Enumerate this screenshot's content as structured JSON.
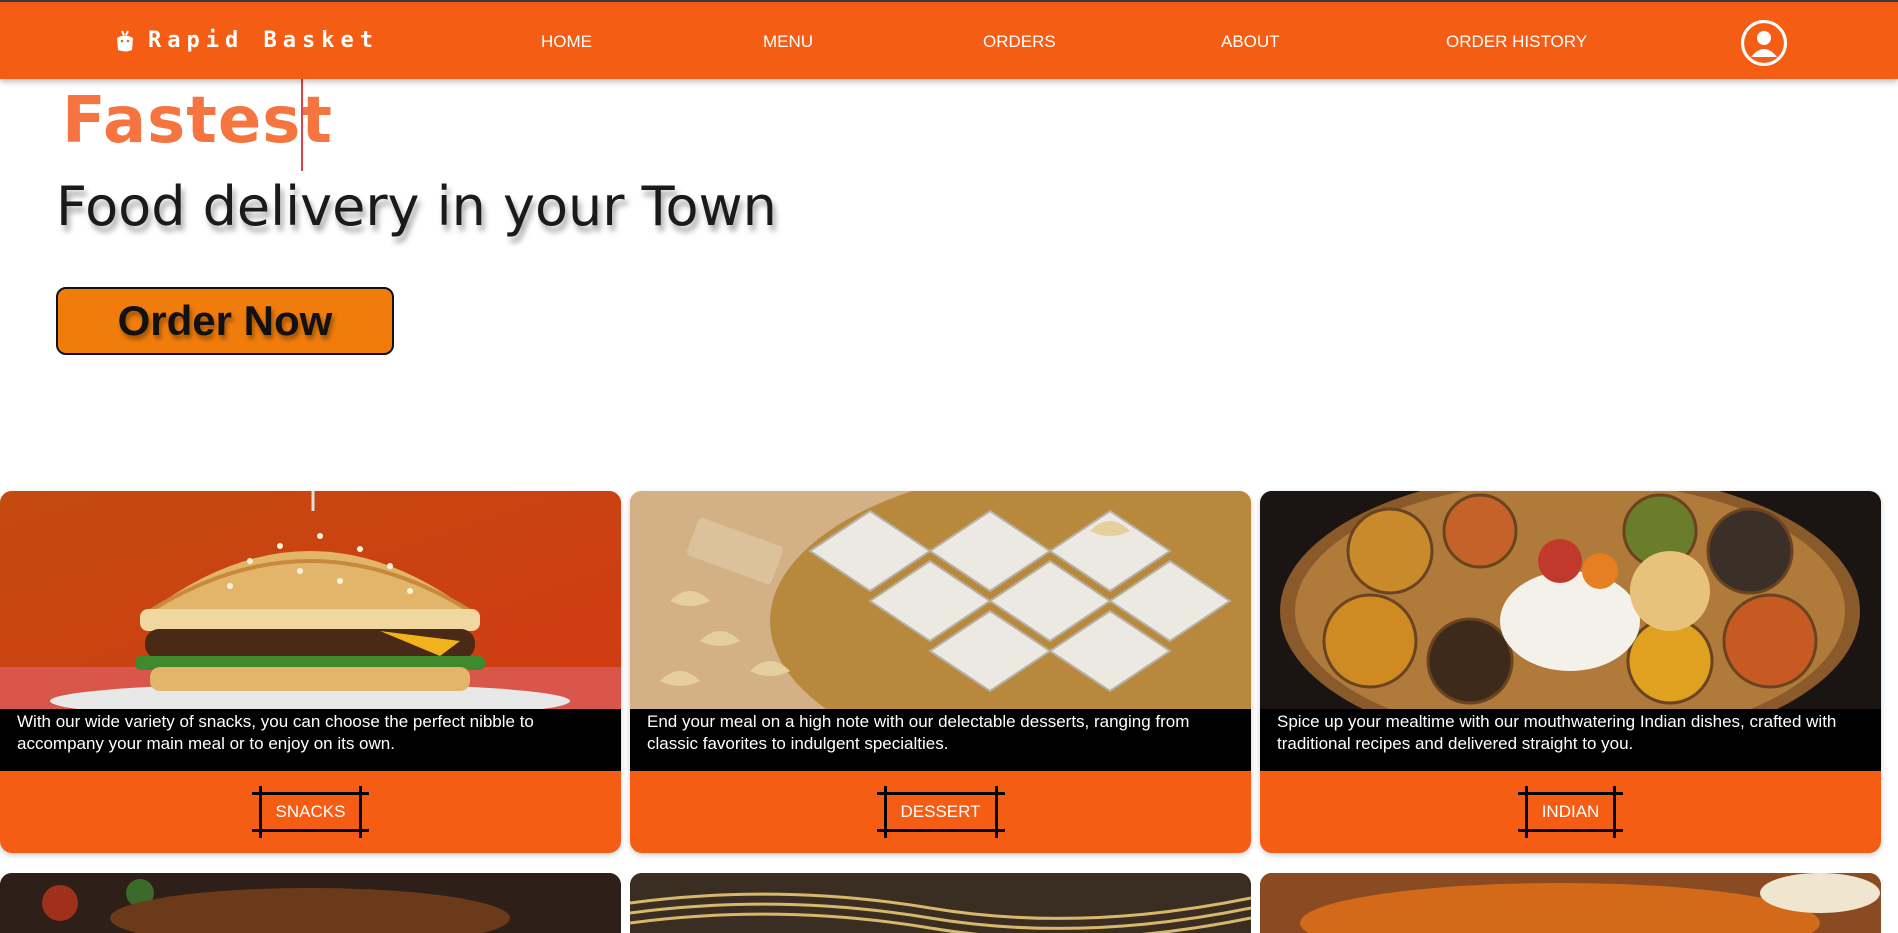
{
  "brand": {
    "name": "Rapid Basket",
    "icon": "basket-icon"
  },
  "nav": {
    "items": [
      {
        "label": "HOME"
      },
      {
        "label": "MENU"
      },
      {
        "label": "ORDERS"
      },
      {
        "label": "ABOUT"
      },
      {
        "label": "ORDER HISTORY"
      }
    ],
    "profile_icon": "user-avatar-icon"
  },
  "hero": {
    "headline": "Fastest",
    "tagline": "Food delivery in your Town",
    "cta_label": "Order Now"
  },
  "categories": [
    {
      "label": "SNACKS",
      "description": "With our wide variety of snacks, you can choose the perfect nibble to accompany your main meal or to enjoy on its own.",
      "image": "burger"
    },
    {
      "label": "DESSERT",
      "description": "End your meal on a high note with our delectable desserts, ranging from classic favorites to indulgent specialties.",
      "image": "kaju-katli"
    },
    {
      "label": "INDIAN",
      "description": "Spice up your mealtime with our mouthwatering Indian dishes, crafted with traditional recipes and delivered straight to you.",
      "image": "thali"
    }
  ],
  "colors": {
    "accent": "#f55d14",
    "cta": "#f07c0c",
    "headline": "#f5743f"
  }
}
